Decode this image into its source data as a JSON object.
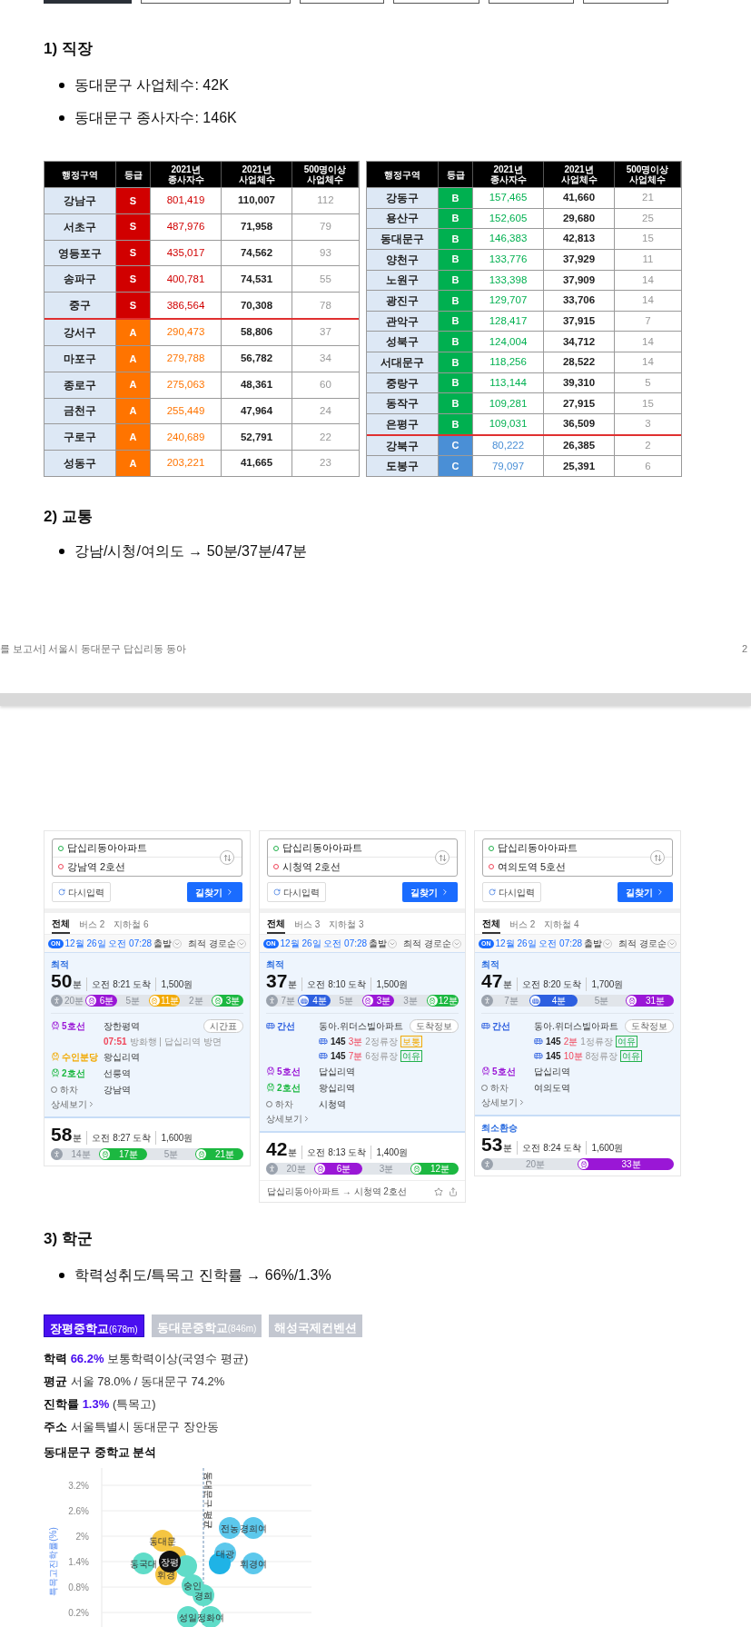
{
  "top_buttons": [
    {
      "selected": true
    },
    {
      "selected": false
    },
    {
      "selected": false
    },
    {
      "selected": false
    },
    {
      "selected": false
    },
    {
      "selected": false
    }
  ],
  "workplace": {
    "heading": "1) 직장",
    "bullets": [
      "동대문구 사업체수: 42K",
      "동대문구 종사자수: 146K"
    ],
    "tables": [
      {
        "columns": [
          "행정구역",
          "등급",
          "2021년\n종사자수",
          "2021년\n사업체수",
          "500명이상\n사업체수"
        ],
        "rows": [
          {
            "district": "강남구",
            "grade": "S",
            "color": "#d10000",
            "employees": "801,419",
            "businesses": "110,007",
            "large": "112"
          },
          {
            "district": "서초구",
            "grade": "S",
            "color": "#d10000",
            "employees": "487,976",
            "businesses": "71,958",
            "large": "79"
          },
          {
            "district": "영등포구",
            "grade": "S",
            "color": "#d10000",
            "employees": "435,017",
            "businesses": "74,562",
            "large": "93"
          },
          {
            "district": "송파구",
            "grade": "S",
            "color": "#d10000",
            "employees": "400,781",
            "businesses": "74,531",
            "large": "55"
          },
          {
            "district": "중구",
            "grade": "S",
            "color": "#d10000",
            "employees": "386,564",
            "businesses": "70,308",
            "large": "78"
          },
          {
            "district": "강서구",
            "grade": "A",
            "color": "#ff7400",
            "employees": "290,473",
            "businesses": "58,806",
            "large": "37"
          },
          {
            "district": "마포구",
            "grade": "A",
            "color": "#ff7400",
            "employees": "279,788",
            "businesses": "56,782",
            "large": "34"
          },
          {
            "district": "종로구",
            "grade": "A",
            "color": "#ff7400",
            "employees": "275,063",
            "businesses": "48,361",
            "large": "60"
          },
          {
            "district": "금천구",
            "grade": "A",
            "color": "#ff7400",
            "employees": "255,449",
            "businesses": "47,964",
            "large": "24"
          },
          {
            "district": "구로구",
            "grade": "A",
            "color": "#ff7400",
            "employees": "240,689",
            "businesses": "52,791",
            "large": "22"
          },
          {
            "district": "성동구",
            "grade": "A",
            "color": "#ff7400",
            "employees": "203,221",
            "businesses": "41,665",
            "large": "23"
          }
        ]
      },
      {
        "columns": [
          "행정구역",
          "등급",
          "2021년\n종사자수",
          "2021년\n사업체수",
          "500명이상\n사업체수"
        ],
        "rows": [
          {
            "district": "강동구",
            "grade": "B",
            "color": "#00b050",
            "employees": "157,465",
            "businesses": "41,660",
            "large": "21"
          },
          {
            "district": "용산구",
            "grade": "B",
            "color": "#00b050",
            "employees": "152,605",
            "businesses": "29,680",
            "large": "25"
          },
          {
            "district": "동대문구",
            "grade": "B",
            "color": "#00b050",
            "employees": "146,383",
            "businesses": "42,813",
            "large": "15"
          },
          {
            "district": "양천구",
            "grade": "B",
            "color": "#00b050",
            "employees": "133,776",
            "businesses": "37,929",
            "large": "11"
          },
          {
            "district": "노원구",
            "grade": "B",
            "color": "#00b050",
            "employees": "133,398",
            "businesses": "37,909",
            "large": "14"
          },
          {
            "district": "광진구",
            "grade": "B",
            "color": "#00b050",
            "employees": "129,707",
            "businesses": "33,706",
            "large": "14"
          },
          {
            "district": "관악구",
            "grade": "B",
            "color": "#00b050",
            "employees": "128,417",
            "businesses": "37,915",
            "large": "7"
          },
          {
            "district": "성북구",
            "grade": "B",
            "color": "#00b050",
            "employees": "124,004",
            "businesses": "34,712",
            "large": "14"
          },
          {
            "district": "서대문구",
            "grade": "B",
            "color": "#00b050",
            "employees": "118,256",
            "businesses": "28,522",
            "large": "14"
          },
          {
            "district": "중랑구",
            "grade": "B",
            "color": "#00b050",
            "employees": "113,144",
            "businesses": "39,310",
            "large": "5"
          },
          {
            "district": "동작구",
            "grade": "B",
            "color": "#00b050",
            "employees": "109,281",
            "businesses": "27,915",
            "large": "15"
          },
          {
            "district": "은평구",
            "grade": "B",
            "color": "#00b050",
            "employees": "109,031",
            "businesses": "36,509",
            "large": "3"
          },
          {
            "district": "강북구",
            "grade": "C",
            "color": "#4a8fd6",
            "employees": "80,222",
            "businesses": "26,385",
            "large": "2"
          },
          {
            "district": "도봉구",
            "grade": "C",
            "color": "#4a8fd6",
            "employees": "79,097",
            "businesses": "25,391",
            "large": "6"
          }
        ]
      }
    ]
  },
  "transport": {
    "heading": "2) 교통",
    "bullets": [
      "강남/시청/여의도 → 50분/37분/47분"
    ]
  },
  "footer": {
    "text": "를 보고서] 서울시 동대문구 답십리동 동아",
    "page": "2"
  },
  "route_cards": [
    {
      "origin": "답십리동아아파트",
      "destination": "강남역 2호선",
      "reset": "다시입력",
      "search": "길찾기",
      "tabs": [
        {
          "label": "전체",
          "selected": true
        },
        {
          "label": "버스 2",
          "selected": false
        },
        {
          "label": "지하철 6",
          "selected": false
        }
      ],
      "on_badge": "ON",
      "departure": "12월 26일 오전 07:28",
      "departure_suffix": "출발",
      "sort": "최적 경로순",
      "routes": [
        {
          "selected": true,
          "tag": "최적",
          "minutes": "50",
          "unit": "분",
          "arrival": "오전 8:21 도착",
          "fare": "1,500원",
          "segments": [
            {
              "kind": "walk",
              "label": "20분"
            },
            {
              "kind": "subway",
              "color": "#9a17d6",
              "label": "6분"
            },
            {
              "kind": "walk",
              "label": "5분"
            },
            {
              "kind": "subway",
              "color": "#f2a900",
              "label": "11분"
            },
            {
              "kind": "walk",
              "label": "2분"
            },
            {
              "kind": "subway",
              "color": "#1cb841",
              "label": "3분"
            }
          ],
          "legs": [
            {
              "kind": "subway",
              "color": "#9a17d6",
              "line": "5호선",
              "stop": "장한평역",
              "button": "시간표"
            },
            {
              "kind": "schedule",
              "time": "07:51",
              "text": "방화행 | 답십리역 방면"
            },
            {
              "kind": "subway",
              "color": "#f2a900",
              "line": "수인분당",
              "stop": "왕십리역"
            },
            {
              "kind": "subway",
              "color": "#1cb841",
              "line": "2호선",
              "stop": "선릉역"
            },
            {
              "kind": "alight",
              "line": "하차",
              "stop": "강남역"
            }
          ],
          "detail": "상세보기"
        },
        {
          "selected": false,
          "minutes": "58",
          "unit": "분",
          "arrival": "오전 8:27 도착",
          "fare": "1,600원",
          "segments": [
            {
              "kind": "walk",
              "label": "14분"
            },
            {
              "kind": "subway",
              "color": "#1cb841",
              "label": "17분"
            },
            {
              "kind": "walk",
              "label": "5분"
            },
            {
              "kind": "subway",
              "color": "#1cb841",
              "label": "21분"
            }
          ]
        }
      ]
    },
    {
      "origin": "답십리동아아파트",
      "destination": "시청역 2호선",
      "reset": "다시입력",
      "search": "길찾기",
      "tabs": [
        {
          "label": "전체",
          "selected": true
        },
        {
          "label": "버스 3",
          "selected": false
        },
        {
          "label": "지하철 3",
          "selected": false
        }
      ],
      "on_badge": "ON",
      "departure": "12월 26일 오전 07:28",
      "departure_suffix": "출발",
      "sort": "최적 경로순",
      "routes": [
        {
          "selected": true,
          "tag": "최적",
          "minutes": "37",
          "unit": "분",
          "arrival": "오전 8:10 도착",
          "fare": "1,500원",
          "segments": [
            {
              "kind": "walk",
              "label": "7분"
            },
            {
              "kind": "bus",
              "color": "#2d5fe0",
              "label": "4분"
            },
            {
              "kind": "walk",
              "label": "5분"
            },
            {
              "kind": "subway",
              "color": "#9a17d6",
              "label": "3분"
            },
            {
              "kind": "walk",
              "label": "3분"
            },
            {
              "kind": "subway",
              "color": "#1cb841",
              "label": "12분"
            }
          ],
          "legs": [
            {
              "kind": "bus",
              "color": "#2d5fe0",
              "line": "간선",
              "stop": "동아.위더스빌아파트",
              "button": "도착정보"
            },
            {
              "kind": "arrival",
              "number": "145",
              "eta": "3분",
              "stop": "2정류장",
              "status": "보통",
              "color": "#f2a900"
            },
            {
              "kind": "arrival",
              "number": "145",
              "eta": "7분",
              "stop": "6정류장",
              "status": "여유",
              "color": "#22b14c"
            },
            {
              "kind": "subway",
              "color": "#9a17d6",
              "line": "5호선",
              "stop": "답십리역"
            },
            {
              "kind": "subway",
              "color": "#1cb841",
              "line": "2호선",
              "stop": "왕십리역"
            },
            {
              "kind": "alight",
              "line": "하차",
              "stop": "시청역"
            }
          ],
          "detail": "상세보기"
        },
        {
          "selected": false,
          "minutes": "42",
          "unit": "분",
          "arrival": "오전 8:13 도착",
          "fare": "1,400원",
          "segments": [
            {
              "kind": "walk",
              "label": "20분"
            },
            {
              "kind": "subway",
              "color": "#9a17d6",
              "label": "6분"
            },
            {
              "kind": "walk",
              "label": "3분"
            },
            {
              "kind": "subway",
              "color": "#1cb841",
              "label": "12분"
            }
          ]
        }
      ],
      "footer": "답십리동아아파트 → 시청역 2호선"
    },
    {
      "origin": "답십리동아아파트",
      "destination": "여의도역 5호선",
      "reset": "다시입력",
      "search": "길찾기",
      "tabs": [
        {
          "label": "전체",
          "selected": true
        },
        {
          "label": "버스 2",
          "selected": false
        },
        {
          "label": "지하철 4",
          "selected": false
        }
      ],
      "on_badge": "ON",
      "departure": "12월 26일 오전 07:28",
      "departure_suffix": "출발",
      "sort": "최적 경로순",
      "routes": [
        {
          "selected": true,
          "tag": "최적",
          "minutes": "47",
          "unit": "분",
          "arrival": "오전 8:20 도착",
          "fare": "1,700원",
          "segments": [
            {
              "kind": "walk",
              "label": "7분"
            },
            {
              "kind": "bus",
              "color": "#2d5fe0",
              "label": "4분"
            },
            {
              "kind": "walk",
              "label": "5분"
            },
            {
              "kind": "subway",
              "color": "#9a17d6",
              "label": "31분"
            }
          ],
          "legs": [
            {
              "kind": "bus",
              "color": "#2d5fe0",
              "line": "간선",
              "stop": "동아.위더스빌아파트",
              "button": "도착정보"
            },
            {
              "kind": "arrival",
              "number": "145",
              "eta": "2분",
              "stop": "1정류장",
              "status": "여유",
              "color": "#22b14c"
            },
            {
              "kind": "arrival",
              "number": "145",
              "eta": "10분",
              "stop": "8정류장",
              "status": "여유",
              "color": "#22b14c"
            },
            {
              "kind": "subway",
              "color": "#9a17d6",
              "line": "5호선",
              "stop": "답십리역"
            },
            {
              "kind": "alight",
              "line": "하차",
              "stop": "여의도역"
            }
          ],
          "detail": "상세보기"
        },
        {
          "selected": false,
          "tag": "최소환승",
          "minutes": "53",
          "unit": "분",
          "arrival": "오전 8:24 도착",
          "fare": "1,600원",
          "segments": [
            {
              "kind": "walk",
              "label": "20분"
            },
            {
              "kind": "subway",
              "color": "#9a17d6",
              "label": "33분"
            }
          ]
        }
      ]
    }
  ],
  "school": {
    "heading": "3) 학군",
    "bullets": [
      "학력성취도/특목고 진학률 → 66%/1.3%"
    ],
    "tabs": [
      {
        "name": "장평중학교",
        "distance": "(678m)",
        "selected": true
      },
      {
        "name": "동대문중학교",
        "distance": "(846m)",
        "selected": false
      },
      {
        "name": "해성국제컨벤션",
        "selected": false
      }
    ],
    "info": [
      {
        "label": "학력",
        "highlight": "66.2%",
        "text": "보통학력이상(국영수 평균)"
      },
      {
        "label": "평균",
        "text": "서울 78.0% / 동대문구 74.2%"
      },
      {
        "label": "진학률",
        "highlight": "1.3%",
        "text": "(특목고)"
      },
      {
        "label": "주소",
        "text": "서울특별시 동대문구 장안동"
      }
    ],
    "chart_title": "동대문구 중학교 분석",
    "chart": {
      "ylabel": "특목고진학률(%)",
      "yticks": [
        "3.2%",
        "2.6%",
        "2%",
        "1.4%",
        "0.8%",
        "0.2%"
      ],
      "reference_label": "동대문구 평균",
      "bubbles": [
        {
          "label": "동대문",
          "color": "#f5c542"
        },
        {
          "label": "휘경",
          "color": "#f5c542"
        },
        {
          "color": "#f5c542"
        },
        {
          "label": "동국대",
          "color": "#5fdcc8"
        },
        {
          "color": "#5fdcc8"
        },
        {
          "label": "전농",
          "color": "#5cc8ec"
        },
        {
          "label": "경희여",
          "color": "#5cc8ec"
        },
        {
          "label": "대광",
          "color": "#5cc8ec"
        },
        {
          "color": "#1fb3e6"
        },
        {
          "label": "휘경여",
          "color": "#5cc8ec"
        },
        {
          "label": "숭인",
          "color": "#5fdcc8"
        },
        {
          "label": "경희",
          "color": "#5fdcc8"
        },
        {
          "label": "성일",
          "color": "#5fdcc8"
        },
        {
          "label": "정화여",
          "color": "#5fdcc8"
        },
        {
          "label": "장평",
          "color": "#111111"
        }
      ]
    }
  }
}
